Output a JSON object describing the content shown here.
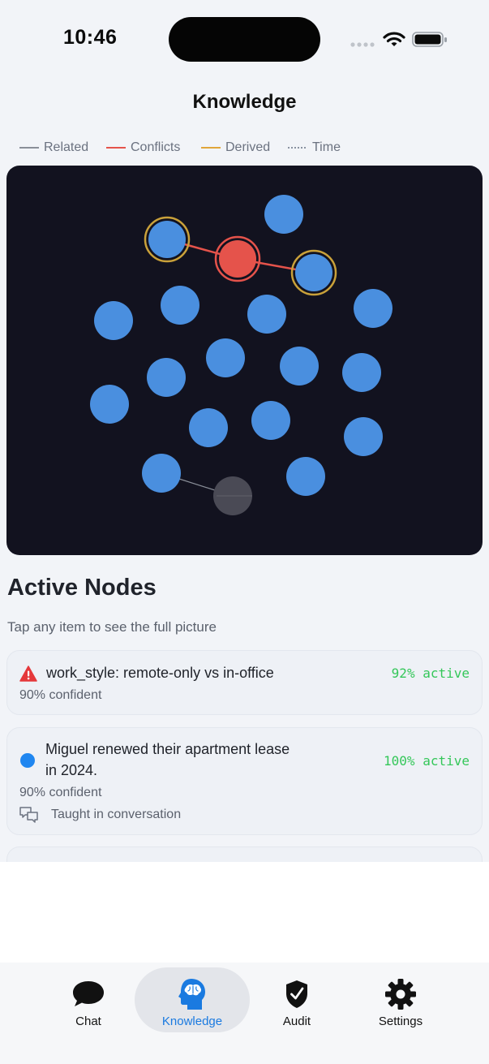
{
  "status_bar": {
    "time": "10:46"
  },
  "header": {
    "title": "Knowledge"
  },
  "legend": [
    {
      "label": "Related",
      "color": "#8a8f99",
      "style": "solid"
    },
    {
      "label": "Conflicts",
      "color": "#e5534b",
      "style": "solid"
    },
    {
      "label": "Derived",
      "color": "#e0a63a",
      "style": "solid"
    },
    {
      "label": "Time",
      "color": "#8a93a1",
      "style": "dotted"
    }
  ],
  "graph": {
    "background": "#12121f",
    "node_color": "#4a8fdf",
    "conflict_color": "#e5534b",
    "derived_ring_color": "#c9a13a",
    "inactive_color": "#4a4a55",
    "nodes": [
      {
        "id": "n1",
        "kind": "derived"
      },
      {
        "id": "n2",
        "kind": "conflict"
      },
      {
        "id": "n3",
        "kind": "derived"
      },
      {
        "id": "n4",
        "kind": "normal"
      },
      {
        "id": "n5",
        "kind": "normal"
      },
      {
        "id": "n6",
        "kind": "normal"
      },
      {
        "id": "n7",
        "kind": "normal"
      },
      {
        "id": "n8",
        "kind": "normal"
      },
      {
        "id": "n9",
        "kind": "normal"
      },
      {
        "id": "n10",
        "kind": "normal"
      },
      {
        "id": "n11",
        "kind": "normal"
      },
      {
        "id": "n12",
        "kind": "normal"
      },
      {
        "id": "n13",
        "kind": "normal"
      },
      {
        "id": "n14",
        "kind": "normal"
      },
      {
        "id": "n15",
        "kind": "normal"
      },
      {
        "id": "n16",
        "kind": "normal"
      },
      {
        "id": "n17",
        "kind": "normal"
      },
      {
        "id": "n18",
        "kind": "normal"
      },
      {
        "id": "n19",
        "kind": "inactive"
      }
    ]
  },
  "active_nodes": {
    "title": "Active Nodes",
    "subtitle": "Tap any item to see the full picture",
    "items": [
      {
        "icon": "warning-icon",
        "title": "work_style: remote-only vs in-office",
        "confidence": "90% confident",
        "status": "92% active"
      },
      {
        "icon": "blue-dot-icon",
        "title_line1": "Miguel renewed their apartment lease",
        "title_line2": "in 2024.",
        "confidence": "90% confident",
        "source": "Taught in conversation",
        "status": "100% active"
      }
    ]
  },
  "tabs": [
    {
      "label": "Chat",
      "icon": "chat-bubble-icon",
      "selected": false
    },
    {
      "label": "Knowledge",
      "icon": "brain-head-icon",
      "selected": true
    },
    {
      "label": "Audit",
      "icon": "shield-check-icon",
      "selected": false
    },
    {
      "label": "Settings",
      "icon": "gear-icon",
      "selected": false
    }
  ],
  "colors": {
    "accent": "#1a7ae0",
    "active_green": "#34c759",
    "warning_red": "#e5383b"
  }
}
